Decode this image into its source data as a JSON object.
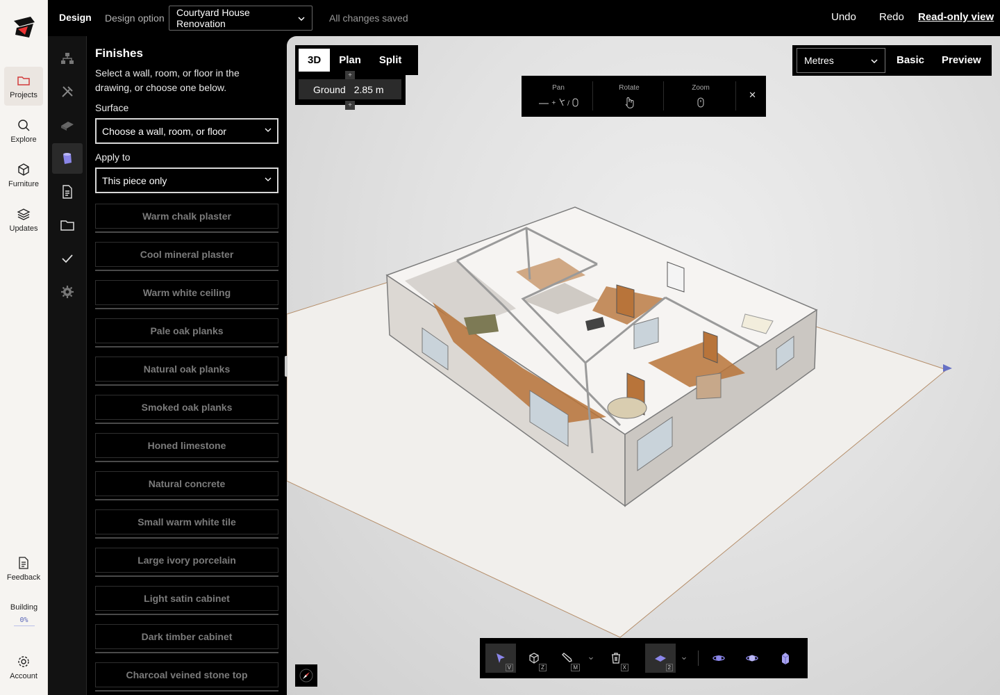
{
  "nav": {
    "items": [
      {
        "label": "Projects",
        "icon": "folder-icon",
        "active": true
      },
      {
        "label": "Explore",
        "icon": "search-icon"
      },
      {
        "label": "Furniture",
        "icon": "cube-icon"
      },
      {
        "label": "Updates",
        "icon": "layers-icon"
      }
    ],
    "feedback": "Feedback",
    "building_label": "Building",
    "building_pct": "0%",
    "account": "Account"
  },
  "topbar": {
    "design": "Design",
    "design_option_label": "Design option",
    "project": "Courtyard House Renovation",
    "status": "All changes saved",
    "undo": "Undo",
    "redo": "Redo",
    "readonly": "Read-only view"
  },
  "tools": [
    "hierarchy-icon",
    "tools-icon",
    "roof-icon",
    "paint-bucket-icon",
    "document-icon",
    "folder-icon",
    "check-icon",
    "settings-icon"
  ],
  "finishes": {
    "title": "Finishes",
    "description": "Select a wall, room, or floor in the drawing, or choose one below.",
    "surface_label": "Surface",
    "surface_value": "Choose a wall, room, or floor",
    "apply_label": "Apply to",
    "apply_value": "This piece only",
    "items": [
      "Warm chalk plaster",
      "Cool mineral plaster",
      "Warm white ceiling",
      "Pale oak planks",
      "Natural oak planks",
      "Smoked oak planks",
      "Honed limestone",
      "Natural concrete",
      "Small warm white tile",
      "Large ivory porcelain",
      "Light satin cabinet",
      "Dark timber cabinet",
      "Charcoal veined stone top"
    ]
  },
  "viewport": {
    "tabs": [
      "3D",
      "Plan",
      "Split"
    ],
    "active_tab": "3D",
    "level": "Ground",
    "level_height": "2.85 m",
    "hints": {
      "pan": "Pan",
      "rotate": "Rotate",
      "zoom": "Zoom"
    },
    "units": "Metres",
    "basic": "Basic",
    "preview": "Preview"
  },
  "bottom_tools": [
    {
      "icon": "pointer-icon",
      "key": "V",
      "active": true
    },
    {
      "icon": "box-icon",
      "key": "Z"
    },
    {
      "icon": "pencil-icon",
      "key": "M"
    },
    {
      "icon": "trash-icon",
      "key": "X"
    },
    {
      "icon": "floor-icon",
      "key": "2",
      "active": true
    },
    {
      "icon": "orbit-icon"
    },
    {
      "icon": "globe-icon"
    },
    {
      "icon": "figure-icon"
    }
  ],
  "colors": {
    "accent": "#5a66b8",
    "panel_bg": "#000000",
    "rail_bg": "#f6f4f1",
    "floor_wood": "#b8743a"
  }
}
